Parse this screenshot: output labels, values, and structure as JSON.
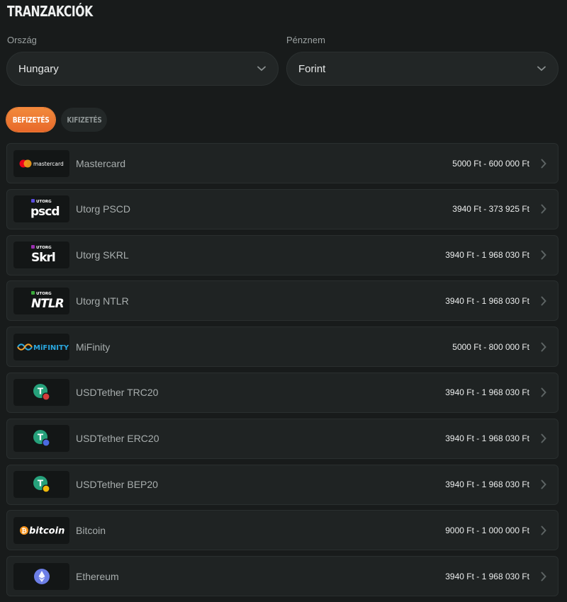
{
  "page": {
    "title": "TRANZAKCIÓK"
  },
  "filters": {
    "country_label": "Ország",
    "country_value": "Hungary",
    "currency_label": "Pénznem",
    "currency_value": "Forint"
  },
  "tabs": [
    {
      "label": "BEFIZETÉS",
      "active": true
    },
    {
      "label": "KIFIZETÉS",
      "active": false
    }
  ],
  "methods": [
    {
      "name": "Mastercard",
      "range": "5000 Ft - 600 000 Ft",
      "logo": "mastercard",
      "logo_text": "mastercard"
    },
    {
      "name": "Utorg PSCD",
      "range": "3940 Ft - 373 925 Ft",
      "logo": "utorg-pscd",
      "logo_text": "pscd",
      "logo_small": "UTORG"
    },
    {
      "name": "Utorg SKRL",
      "range": "3940 Ft - 1 968 030 Ft",
      "logo": "utorg-skrl",
      "logo_text": "Skrl",
      "logo_small": "UTORG"
    },
    {
      "name": "Utorg NTLR",
      "range": "3940 Ft - 1 968 030 Ft",
      "logo": "utorg-ntlr",
      "logo_text": "NTLR",
      "logo_small": "UTORG"
    },
    {
      "name": "MiFinity",
      "range": "5000 Ft - 800 000 Ft",
      "logo": "mifinity",
      "logo_text": "MiFINITY"
    },
    {
      "name": "USDTether TRC20",
      "range": "3940 Ft - 1 968 030 Ft",
      "logo": "tether-trc20"
    },
    {
      "name": "USDTether ERC20",
      "range": "3940 Ft - 1 968 030 Ft",
      "logo": "tether-erc20"
    },
    {
      "name": "USDTether BEP20",
      "range": "3940 Ft - 1 968 030 Ft",
      "logo": "tether-bep20"
    },
    {
      "name": "Bitcoin",
      "range": "9000 Ft - 1 000 000 Ft",
      "logo": "bitcoin",
      "logo_text": "bitcoin"
    },
    {
      "name": "Ethereum",
      "range": "3940 Ft - 1 968 030 Ft",
      "logo": "ethereum"
    }
  ],
  "colors": {
    "accent": "#f08038",
    "background": "#181b1b",
    "row": "#1f2323",
    "tether": "#26a17b"
  }
}
